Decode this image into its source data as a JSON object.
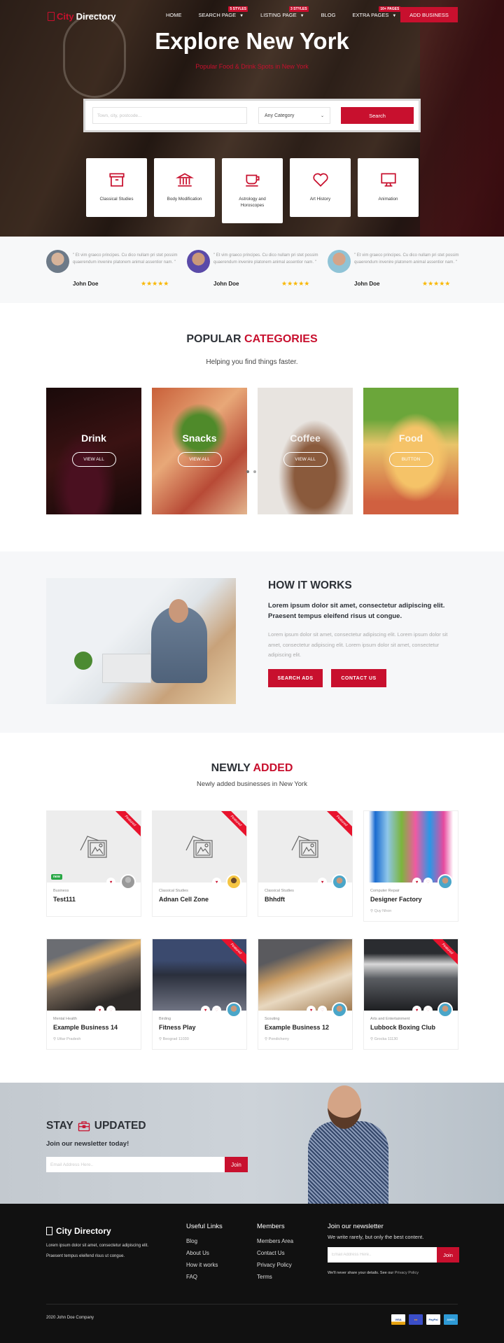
{
  "brand": {
    "name_part1": "City",
    "name_part2": "Directory",
    "accent": "#c8102e"
  },
  "nav": {
    "items": [
      {
        "label": "HOME",
        "badge": null,
        "dropdown": false
      },
      {
        "label": "SEARCH PAGE",
        "badge": "5 STYLES",
        "dropdown": true
      },
      {
        "label": "LISTING PAGE",
        "badge": "3 STYLES",
        "dropdown": true
      },
      {
        "label": "BLOG",
        "badge": null,
        "dropdown": false
      },
      {
        "label": "EXTRA PAGES",
        "badge": "10+ PAGES",
        "dropdown": true
      }
    ],
    "add_business": "ADD BUSINESS"
  },
  "hero": {
    "title": "Explore New York",
    "subtitle": "Popular Food & Drink Spots in New York",
    "search": {
      "placeholder": "Town, city, postcode...",
      "category": "Any Category",
      "button": "Search"
    },
    "tiles": [
      {
        "label": "Classical Studies",
        "icon": "archive-box-icon"
      },
      {
        "label": "Body Modification",
        "icon": "bank-building-icon"
      },
      {
        "label": "Astrology and Horoscopes",
        "icon": "coffee-cup-icon"
      },
      {
        "label": "Art History",
        "icon": "heart-icon"
      },
      {
        "label": "Animation",
        "icon": "monitor-icon"
      }
    ],
    "slides": 2,
    "active_slide": 1
  },
  "testimonials": [
    {
      "text": "\" Et vim graeco principes. Cu dico nullam pri stet possim quaerendum invenire platonem animal assentior nam. \"",
      "name": "John Doe",
      "stars": 5
    },
    {
      "text": "\" Et vim graeco principes. Cu dico nullam pri stet possim quaerendum invenire platonem animal assentior nam. \"",
      "name": "John Doe",
      "stars": 5
    },
    {
      "text": "\" Et vim graeco principes. Cu dico nullam pri stet possim quaerendum invenire platonem animal assentior nam. \"",
      "name": "John Doe",
      "stars": 5
    }
  ],
  "popular": {
    "title_dark": "POPULAR",
    "title_red": "CATEGORIES",
    "subtitle": "Helping you find things faster.",
    "cards": [
      {
        "title": "Drink",
        "button": "VIEW ALL"
      },
      {
        "title": "Snacks",
        "button": "VIEW ALL"
      },
      {
        "title": "Coffee",
        "button": "VIEW ALL"
      },
      {
        "title": "Food",
        "button": "BUTTON"
      }
    ]
  },
  "how": {
    "title": "HOW IT WORKS",
    "lead": "Lorem ipsum dolor sit amet, consectetur adipiscing elit. Praesent tempus eleifend risus ut congue.",
    "body": "Lorem ipsum dolor sit amet, consectetur adipiscing elit. Lorem ipsum dolor sit amet, consectetur adipiscing elit. Lorem ipsum dolor sit amet, consectetur adipiscing elit.",
    "btn1": "SEARCH ADS",
    "btn2": "CONTACT US"
  },
  "newly": {
    "title_dark": "NEWLY",
    "title_red": "ADDED",
    "subtitle": "Newly added businesses in New York",
    "featured_label": "Featured",
    "new_label": "new",
    "listings": [
      {
        "category": "Business",
        "name": "Test111",
        "location": "",
        "featured": true,
        "new": true
      },
      {
        "category": "Classical Studies",
        "name": "Adnan Cell Zone",
        "location": "",
        "featured": true,
        "new": false
      },
      {
        "category": "Classical Studies",
        "name": "Bhhdft",
        "location": "",
        "featured": true,
        "new": false
      },
      {
        "category": "Computer Repair",
        "name": "Designer Factory",
        "location": "Quy Nhon",
        "featured": false,
        "new": false
      },
      {
        "category": "Mental Health",
        "name": "Example Business 14",
        "location": "Uttar Pradesh",
        "featured": false,
        "new": false
      },
      {
        "category": "Birding",
        "name": "Fitness Play",
        "location": "Beograd 11030",
        "featured": true,
        "new": false
      },
      {
        "category": "Scouting",
        "name": "Example Business 12",
        "location": "Pondicherry",
        "featured": false,
        "new": false
      },
      {
        "category": "Arts and Entertainment",
        "name": "Lubbock Boxing Club",
        "location": "Grocka 11130",
        "featured": true,
        "new": false
      }
    ]
  },
  "stay": {
    "title1": "STAY",
    "title2": "UPDATED",
    "subtitle": "Join our newsletter today!",
    "placeholder": "Email Address Here..",
    "button": "Join"
  },
  "footer": {
    "brand": "City Directory",
    "about_line1": "Lorem ipsum dolor sit amet, consectetur adipiscing elit.",
    "about_line2": "Praesent tempus eleifend risus ut congue.",
    "useful_title": "Useful Links",
    "useful": [
      "Blog",
      "About Us",
      "How it works",
      "FAQ"
    ],
    "members_title": "Members",
    "members": [
      "Members Area",
      "Contact Us",
      "Privacy Policy",
      "Terms"
    ],
    "news_title": "Join our newsletter",
    "news_text": "We write rarely, but only the best content.",
    "news_placeholder": "Email Address Here..",
    "news_button": "Join",
    "note": "We'll never share your details. See our ",
    "note_link": "Privacy Policy",
    "copyright": "2020 John Doe Company",
    "payments": [
      "VISA",
      "MC",
      "PayPal",
      "AMEX"
    ]
  }
}
